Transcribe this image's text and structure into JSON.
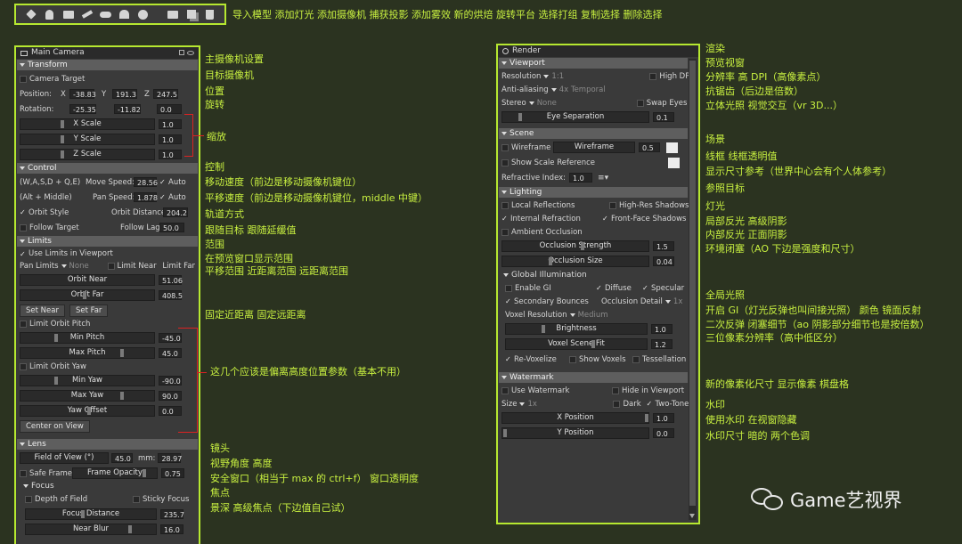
{
  "toolbar": {
    "icons": [
      "cube-icon",
      "light-bulb-icon",
      "camera-icon",
      "capture-icon",
      "fog-icon",
      "bake-icon",
      "turntable-icon",
      "select-group-icon",
      "duplicate-icon",
      "trash-icon"
    ],
    "caption": "导入模型  添加灯光  添加摄像机  捕获投影  添加雾效  新的烘焙  旋转平台  选择打组  复制选择  删除选择"
  },
  "camera": {
    "title": "Main Camera",
    "transform": {
      "header": "Transform",
      "target_camera": "Camera Target",
      "position": {
        "label": "Position:",
        "x_label": "X",
        "x": "-38.83",
        "y_label": "Y",
        "y": "191.3",
        "z_label": "Z",
        "z": "247.5"
      },
      "rotation": {
        "label": "Rotation:",
        "x": "-25.35",
        "y": "-11.82",
        "z": "0.0"
      },
      "scales": [
        {
          "label": "X Scale",
          "value": "1.0"
        },
        {
          "label": "Y Scale",
          "value": "1.0"
        },
        {
          "label": "Z Scale",
          "value": "1.0"
        }
      ]
    },
    "control": {
      "header": "Control",
      "keys1": "(W,A,S,D + Q,E)",
      "move_speed_label": "Move Speed:",
      "move_speed": "28.56",
      "auto1": "Auto",
      "keys2": "(Alt + Middle)",
      "pan_speed_label": "Pan Speed:",
      "pan_speed": "1.878",
      "auto2": "Auto",
      "orbit_style": "Orbit Style",
      "orbit_distance_label": "Orbit Distance:",
      "orbit_distance": "204.2",
      "follow_target": "Follow Target",
      "follow_lag_label": "Follow Lag",
      "follow_lag": "50.0"
    },
    "limits": {
      "header": "Limits",
      "use_limits": "Use Limits in Viewport",
      "pan_limits": "Pan Limits",
      "pan_none": "None",
      "limit_near": "Limit Near",
      "limit_far": "Limit Far",
      "orbit_near_label": "Orbit Near",
      "orbit_near": "51.06",
      "orbit_far_label": "Orbit Far",
      "orbit_far": "408.5",
      "set_near": "Set Near",
      "set_far": "Set Far",
      "limit_orbit_pitch": "Limit Orbit Pitch",
      "min_pitch_label": "Min Pitch",
      "min_pitch": "-45.0",
      "max_pitch_label": "Max Pitch",
      "max_pitch": "45.0",
      "limit_orbit_yaw": "Limit Orbit Yaw",
      "min_yaw_label": "Min Yaw",
      "min_yaw": "-90.0",
      "max_yaw_label": "Max Yaw",
      "max_yaw": "90.0",
      "yaw_offset_label": "Yaw Offset",
      "yaw_offset": "0.0",
      "center_on_view": "Center on View"
    },
    "lens": {
      "header": "Lens",
      "fov_label": "Field of View (°)",
      "fov": "45.0",
      "mm_label": "mm:",
      "mm": "28.97",
      "safe_frame": "Safe Frame",
      "frame_opacity_label": "Frame Opacity",
      "frame_opacity": "0.75",
      "focus_header": "Focus",
      "dof": "Depth of Field",
      "sticky_focus": "Sticky Focus",
      "focus_distance_label": "Focus Distance",
      "focus_distance": "235.7",
      "near_blur_label": "Near Blur",
      "near_blur": "16.0"
    }
  },
  "render": {
    "title": "Render",
    "viewport": {
      "header": "Viewport",
      "resolution_label": "Resolution",
      "resolution": "1:1",
      "high_dpi": "High DPI",
      "aa_label": "Anti-aliasing",
      "aa": "4x Temporal",
      "stereo_label": "Stereo",
      "stereo": "None",
      "swap_eyes": "Swap Eyes",
      "eye_sep_label": "Eye Separation",
      "eye_sep": "0.1"
    },
    "scene": {
      "header": "Scene",
      "wireframe": "Wireframe",
      "wireframe_slider": "Wireframe",
      "wireframe_value": "0.5",
      "show_scale": "Show Scale Reference",
      "refractive_label": "Refractive Index:",
      "refractive": "1.0"
    },
    "lighting": {
      "header": "Lighting",
      "local_refl": "Local Reflections",
      "hires_shadows": "High-Res Shadows",
      "internal_refr": "Internal Refraction",
      "front_shadows": "Front-Face Shadows",
      "ao": "Ambient Occlusion",
      "occ_strength_label": "Occlusion Strength",
      "occ_strength": "1.5",
      "occ_size_label": "Occlusion Size",
      "occ_size": "0.04",
      "gi_header": "Global Illumination",
      "enable_gi": "Enable GI",
      "diffuse": "Diffuse",
      "specular": "Specular",
      "secondary": "Secondary Bounces",
      "occ_detail_label": "Occlusion Detail",
      "occ_detail": "1x",
      "voxel_res_label": "Voxel Resolution",
      "voxel_res": "Medium",
      "brightness_label": "Brightness",
      "brightness": "1.0",
      "voxel_fit_label": "Voxel Scene Fit",
      "voxel_fit": "1.2",
      "revoxelize": "Re-Voxelize",
      "show_voxels": "Show Voxels",
      "tessellation": "Tessellation"
    },
    "watermark": {
      "header": "Watermark",
      "use_watermark": "Use Watermark",
      "hide_viewport": "Hide in Viewport",
      "size_label": "Size",
      "size": "1x",
      "dark": "Dark",
      "two_tone": "Two-Tone",
      "xpos_label": "X Position",
      "xpos": "1.0",
      "ypos_label": "Y Position",
      "ypos": "0.0"
    }
  },
  "annotations_left": {
    "cam_settings": "主摄像机设置",
    "target_cam": "目标摄像机",
    "position": "位置",
    "rotation": "旋转",
    "scale": "缩放",
    "control": "控制",
    "move_speed": "移动速度（前边是移动摄像机键位）",
    "pan_speed": "平移速度（前边是移动摄像机键位，middle 中键）",
    "orbit_style": "轨道方式",
    "follow": "跟随目标   跟随延缓值",
    "range": "范围",
    "show_range": "在预览窗口显示范围",
    "pan_range": "平移范围    近距离范围    远距离范围",
    "fixed_range": "固定近距离    固定远距离",
    "offset_params": "这几个应该是偏离高度位置参数（基本不用）",
    "lens": "镜头",
    "fov": "视野角度    高度",
    "safe_window": "安全窗口（相当于 max 的 ctrl+f）   窗口透明度",
    "focus": "焦点",
    "dof": "景深    高级焦点（下边值自己试）"
  },
  "annotations_right": {
    "render": "渲染",
    "preview": "预览视窗",
    "resolution": "分辨率   高 DPI（高像素点）",
    "aa": "抗锯齿（后边是倍数）",
    "stereo": "立体光照      视觉交互（vr 3D...）",
    "scene": "场景",
    "wireframe": "线框    线框透明值",
    "scale_ref": "显示尺寸参考（世界中心会有个人体参考）",
    "refr": "参照目标",
    "lighting": "灯光",
    "local": "局部反光       高级阴影",
    "internal": "内部反光       正面阴影",
    "ao": "环境闭塞（AO 下边是强度和尺寸）",
    "gi": "全局光照",
    "enable_gi": "开启 GI（灯光反弹也叫间接光照）  颜色  镜面反射",
    "secondary": "二次反弹        闭塞细节（ao 阴影部分细节也是按倍数）",
    "voxel": "三位像素分辨率（高中低区分）",
    "revox": "新的像素化尺寸      显示像素    棋盘格",
    "watermark": "水印",
    "use_wm": "使用水印      在视窗隐藏",
    "wm_size": "水印尺寸      暗的       两个色调"
  },
  "brand": {
    "name": "Game艺视界"
  }
}
